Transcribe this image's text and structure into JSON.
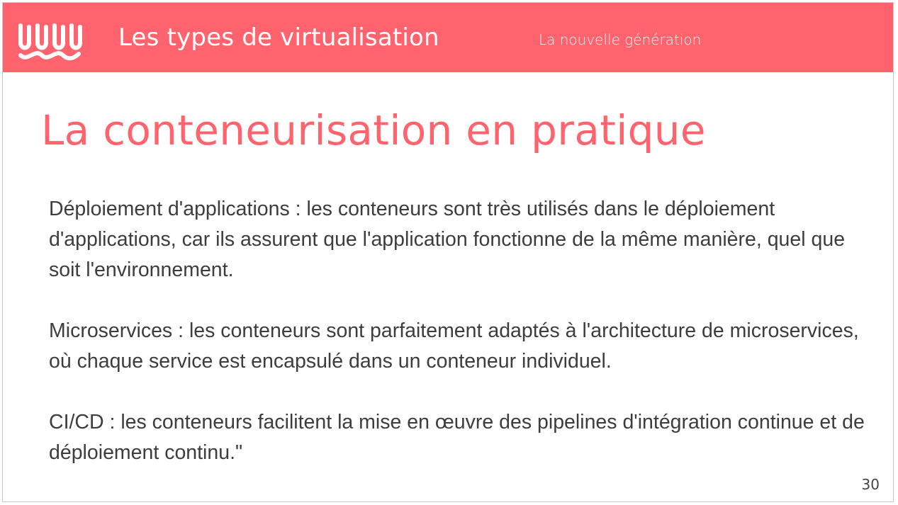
{
  "header": {
    "title": "Les types de virtualisation",
    "subtitle": "La nouvelle génération",
    "logo_icon": "wave-logo-icon",
    "background_color": "#ff646e"
  },
  "slide": {
    "title": "La conteneurisation en pratique",
    "title_color": "#ff646e",
    "paragraphs": [
      "Déploiement d'applications : les conteneurs sont très utilisés dans le déploiement d'applications, car ils assurent que l'application fonctionne de la même manière, quel que soit l'environnement.",
      "Microservices : les conteneurs sont parfaitement adaptés à l'architecture de microservices, où chaque service est encapsulé dans un conteneur individuel.",
      "CI/CD : les conteneurs facilitent la mise en œuvre des pipelines d'intégration continue et de déploiement continu.\""
    ],
    "page_number": "30"
  }
}
